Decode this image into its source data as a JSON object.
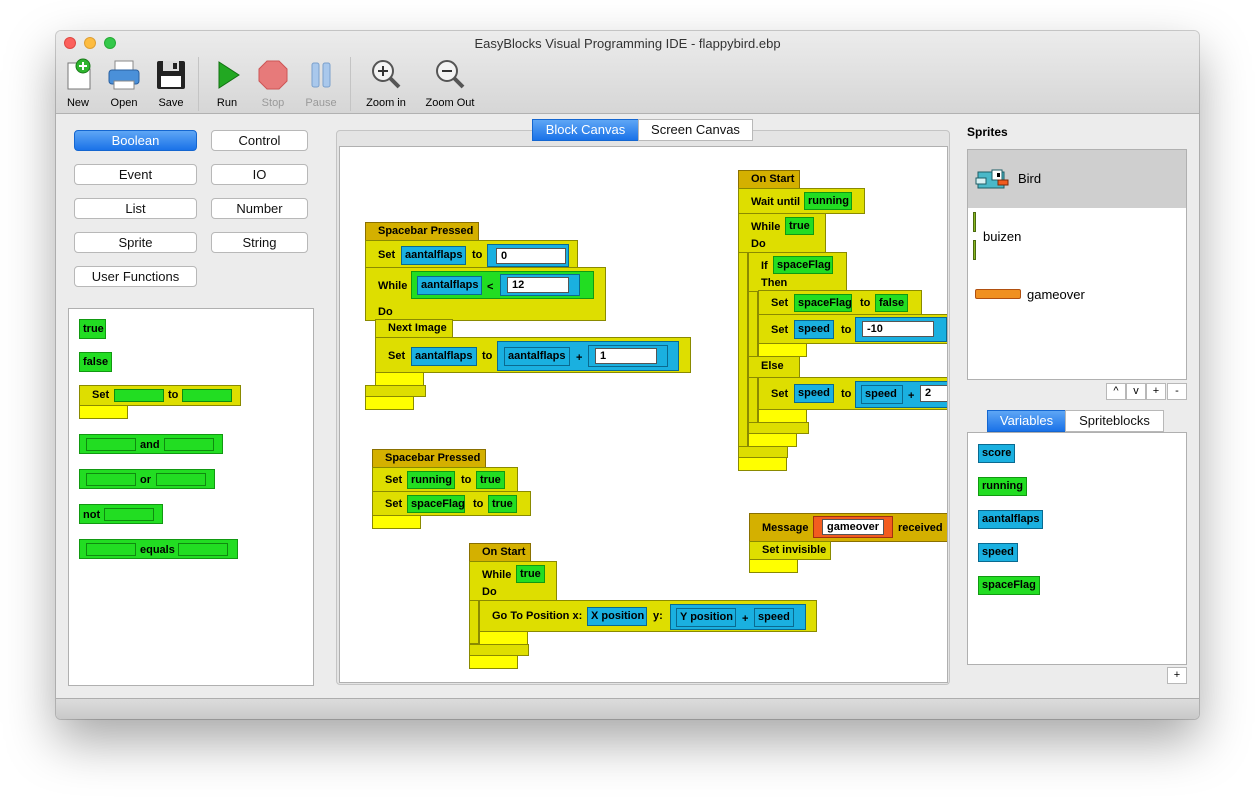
{
  "window": {
    "title": "EasyBlocks Visual Programming IDE - flappybird.ebp"
  },
  "toolbar": {
    "new": "New",
    "open": "Open",
    "save": "Save",
    "run": "Run",
    "stop": "Stop",
    "pause": "Pause",
    "zoom_in": "Zoom in",
    "zoom_out": "Zoom Out"
  },
  "categories": [
    "Boolean",
    "Control",
    "Event",
    "IO",
    "List",
    "Number",
    "Sprite",
    "String",
    "User Functions"
  ],
  "active_category": "Boolean",
  "palette": {
    "true": "true",
    "false": "false",
    "set": "Set",
    "to": "to",
    "and": "and",
    "or": "or",
    "not": "not",
    "equals": "equals"
  },
  "canvas_tabs": [
    "Block Canvas",
    "Screen Canvas"
  ],
  "blocks": {
    "spacebar1": {
      "header": "Spacebar Pressed",
      "set": "Set",
      "var1": "aantalflaps",
      "to": "to",
      "val1": "0",
      "while": "While",
      "cond_var": "aantalflaps",
      "lt": "<",
      "cond_val": "12",
      "do": "Do",
      "next_image": "Next Image",
      "set2": "Set",
      "var2": "aantalflaps",
      "to2": "to",
      "expr_var": "aantalflaps",
      "plus": "+",
      "expr_val": "1"
    },
    "spacebar2": {
      "header": "Spacebar Pressed",
      "set1": "Set",
      "var1": "running",
      "to1": "to",
      "val1": "true",
      "set2": "Set",
      "var2": "spaceFlag",
      "to2": "to",
      "val2": "true"
    },
    "onstart1": {
      "header": "On Start",
      "wait": "Wait until",
      "wait_var": "running",
      "while": "While",
      "while_val": "true",
      "do": "Do",
      "if": "If",
      "if_var": "spaceFlag",
      "then": "Then",
      "set1": "Set",
      "set1_var": "spaceFlag",
      "set1_to": "to",
      "set1_val": "false",
      "set2": "Set",
      "set2_var": "speed",
      "set2_to": "to",
      "set2_val": "-10",
      "else": "Else",
      "set3": "Set",
      "set3_var": "speed",
      "set3_to": "to",
      "set3_expr": "speed",
      "set3_plus": "+",
      "set3_val": "2"
    },
    "message": {
      "label": "Message",
      "value": "gameover",
      "received": "received",
      "set_invisible": "Set invisible"
    },
    "onstart2": {
      "header": "On Start",
      "while": "While",
      "while_val": "true",
      "do": "Do",
      "goto": "Go To Position x:",
      "xpos": "X position",
      "y": "y:",
      "ypos": "Y position",
      "plus": "+",
      "speed": "speed"
    }
  },
  "sprites": {
    "title": "Sprites",
    "items": [
      "Bird",
      "buizen",
      "gameover"
    ],
    "selected": "Bird",
    "buttons": [
      "^",
      "v",
      "+",
      "-"
    ]
  },
  "right_tabs": [
    "Variables",
    "Spriteblocks"
  ],
  "variables": [
    "score",
    "running",
    "aantalflaps",
    "speed",
    "spaceFlag"
  ],
  "vars_add": "+",
  "colors": {
    "boolean_green": "#22dd22",
    "control_yellow": "#dede00",
    "event_gold": "#d4b000",
    "var_blue": "#1ab0e0",
    "accent": "#1a72e8"
  }
}
